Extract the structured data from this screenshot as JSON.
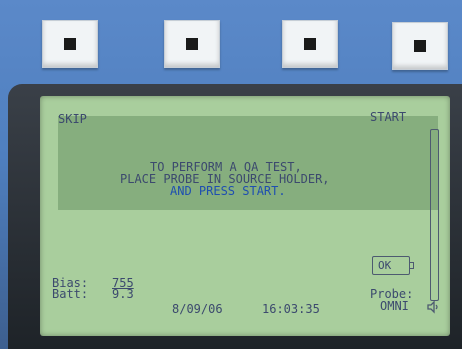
{
  "softkeys": [
    {
      "name": "softkey-1"
    },
    {
      "name": "softkey-2"
    },
    {
      "name": "softkey-3"
    },
    {
      "name": "softkey-4"
    }
  ],
  "screen": {
    "skip_label": "SKIP",
    "start_label": "START",
    "message": [
      "TO PERFORM A QA TEST,",
      "PLACE PROBE IN SOURCE HOLDER,",
      "AND PRESS START."
    ],
    "bias_label": "Bias:",
    "bias_value": "755",
    "batt_label": "Batt:",
    "batt_value": "9.3",
    "date": "8/09/06",
    "time": "16:03:35",
    "ok_label": "OK",
    "probe_label": "Probe:",
    "probe_value": "OMNI",
    "icons": {
      "speaker": "speaker-icon",
      "battery": "battery-ok-icon"
    }
  },
  "colors": {
    "panel_blue": "#4f7fbf",
    "lcd_background": "#a9ce9d",
    "lcd_band": "#86ae7e",
    "lcd_text": "#3c4a6e",
    "lcd_highlight_text": "#1f4fb0"
  }
}
